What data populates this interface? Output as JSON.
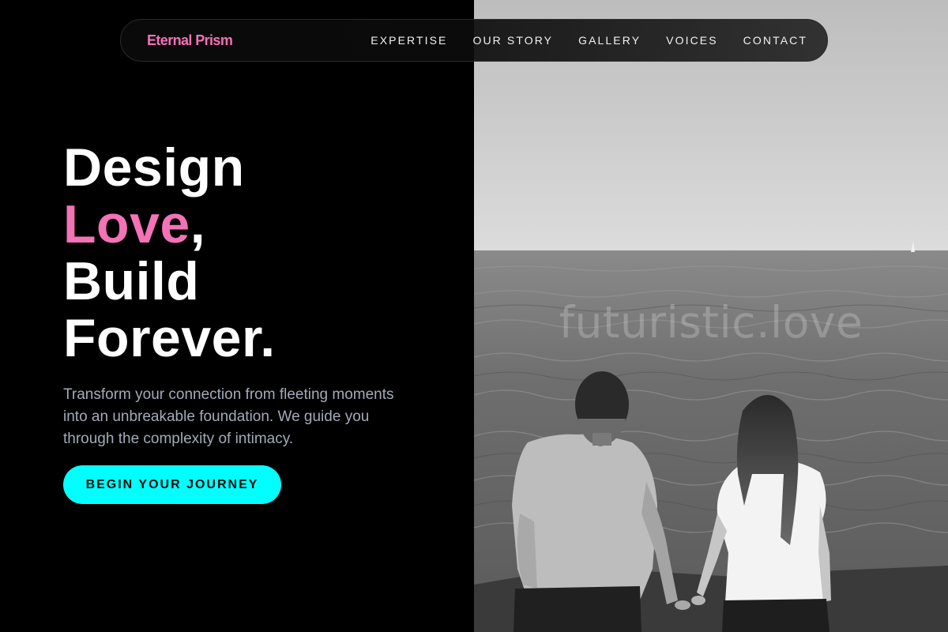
{
  "brand": {
    "name": "Eternal Prism",
    "color": "#f472b6"
  },
  "nav": {
    "items": [
      {
        "label": "EXPERTISE"
      },
      {
        "label": "OUR STORY"
      },
      {
        "label": "GALLERY"
      },
      {
        "label": "VOICES"
      },
      {
        "label": "CONTACT"
      }
    ]
  },
  "hero": {
    "line1": "Design",
    "line2_accent": "Love",
    "line2_punct": ",",
    "line3": "Build",
    "line4": "Forever.",
    "subtitle": "Transform your connection from fleeting moments into an unbreakable foundation. We guide you through the complexity of intimacy.",
    "cta_label": "BEGIN YOUR JOURNEY",
    "accent_color": "#f472b6",
    "cta_color": "#00ffff"
  },
  "image": {
    "watermark": "futuristic.love",
    "subject": "couple-sitting-by-sea-photo"
  }
}
